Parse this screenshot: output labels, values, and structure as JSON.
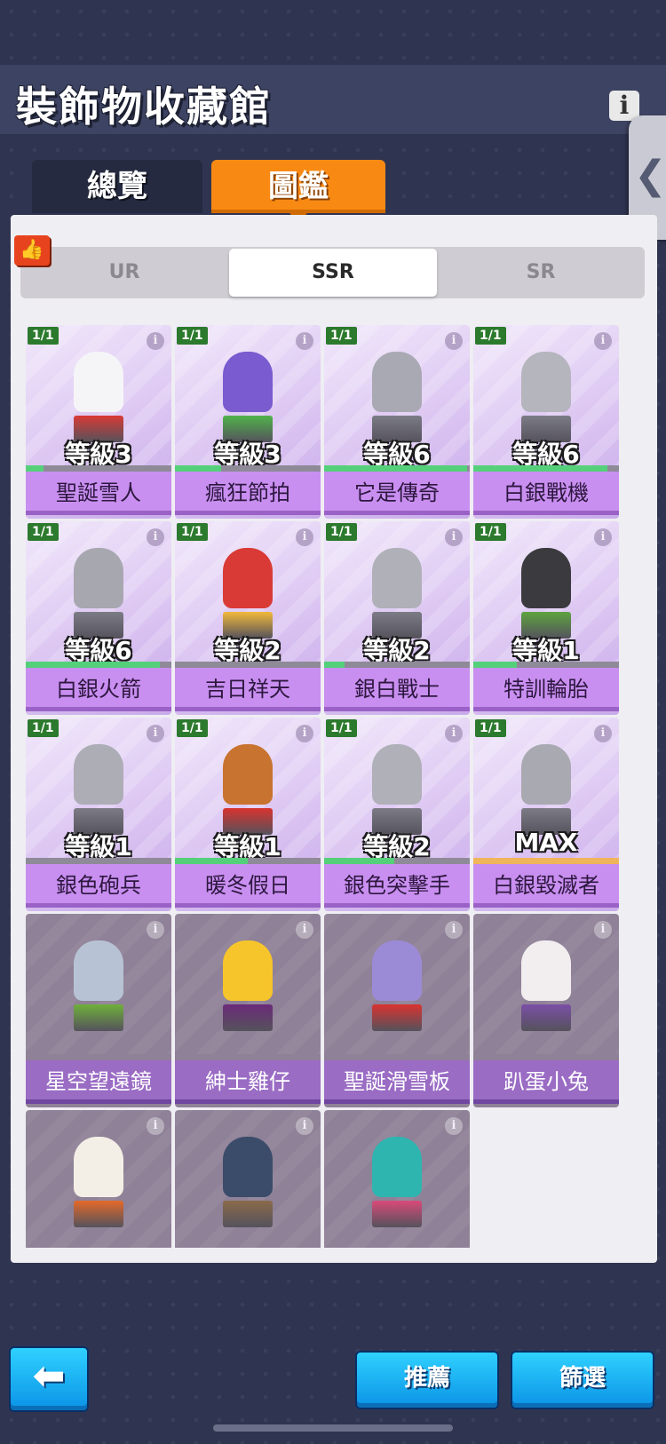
{
  "header": {
    "title": "裝飾物收藏館",
    "info_icon": "i"
  },
  "side": {
    "collapse_icon": "❮"
  },
  "tabs": [
    {
      "label": "總覽",
      "active": false
    },
    {
      "label": "圖鑑",
      "active": true
    }
  ],
  "rarity_tabs": [
    "UR",
    "SSR",
    "SR"
  ],
  "rarity_active": "SSR",
  "recommend_icon": "👍",
  "cards": [
    {
      "name": "聖誕雪人",
      "count": "1/1",
      "level": "等級3",
      "progress": 0.12,
      "owned": true,
      "color": "#f5f5f7",
      "accent": "#d93a35"
    },
    {
      "name": "瘋狂節拍",
      "count": "1/1",
      "level": "等級3",
      "progress": 0.32,
      "owned": true,
      "color": "#7a5bd0",
      "accent": "#4fb34a"
    },
    {
      "name": "它是傳奇",
      "count": "1/1",
      "level": "等級6",
      "progress": 0.98,
      "owned": true,
      "color": "#a9a9b3",
      "accent": "#7c7c86"
    },
    {
      "name": "白銀戰機",
      "count": "1/1",
      "level": "等級6",
      "progress": 0.92,
      "owned": true,
      "color": "#b5b5bd",
      "accent": "#7c7c86"
    },
    {
      "name": "白銀火箭",
      "count": "1/1",
      "level": "等級6",
      "progress": 0.92,
      "owned": true,
      "color": "#a7a7b0",
      "accent": "#7c7c86"
    },
    {
      "name": "吉日祥天",
      "count": "1/1",
      "level": "等級2",
      "progress": 0.0,
      "owned": true,
      "color": "#d93a35",
      "accent": "#f2b93b"
    },
    {
      "name": "銀白戰士",
      "count": "1/1",
      "level": "等級2",
      "progress": 0.14,
      "owned": true,
      "color": "#b0b0b8",
      "accent": "#7c7c86"
    },
    {
      "name": "特訓輪胎",
      "count": "1/1",
      "level": "等級1",
      "progress": 0.3,
      "owned": true,
      "color": "#3b3b3f",
      "accent": "#5ea33f"
    },
    {
      "name": "銀色砲兵",
      "count": "1/1",
      "level": "等級1",
      "progress": 0.0,
      "owned": true,
      "color": "#adadb6",
      "accent": "#7c7c86"
    },
    {
      "name": "暖冬假日",
      "count": "1/1",
      "level": "等級1",
      "progress": 0.5,
      "owned": true,
      "color": "#c8732f",
      "accent": "#d9332f"
    },
    {
      "name": "銀色突擊手",
      "count": "1/1",
      "level": "等級2",
      "progress": 0.48,
      "owned": true,
      "color": "#b0b0b8",
      "accent": "#7c7c86"
    },
    {
      "name": "白銀毀滅者",
      "count": "1/1",
      "level": "MAX",
      "progress": 1.0,
      "owned": true,
      "max": true,
      "color": "#a9a9b2",
      "accent": "#7c7c86"
    },
    {
      "name": "星空望遠鏡",
      "owned": false,
      "color": "#b7c3d4",
      "accent": "#6fb03a"
    },
    {
      "name": "紳士雞仔",
      "owned": false,
      "color": "#f6c52b",
      "accent": "#6b2a7a"
    },
    {
      "name": "聖誕滑雪板",
      "owned": false,
      "color": "#9b8bd6",
      "accent": "#d9332f"
    },
    {
      "name": "趴蛋小兔",
      "owned": false,
      "color": "#f2eef0",
      "accent": "#7b4fa6"
    },
    {
      "name": "",
      "owned": false,
      "color": "#f3efe6",
      "accent": "#e46a2a"
    },
    {
      "name": "",
      "owned": false,
      "color": "#3a4c6a",
      "accent": "#8a6a4a"
    },
    {
      "name": "",
      "owned": false,
      "color": "#2fb5b0",
      "accent": "#d94a7a"
    }
  ],
  "footer": {
    "back_icon": "⬅",
    "recommend_label": "推薦",
    "filter_label": "篩選"
  }
}
